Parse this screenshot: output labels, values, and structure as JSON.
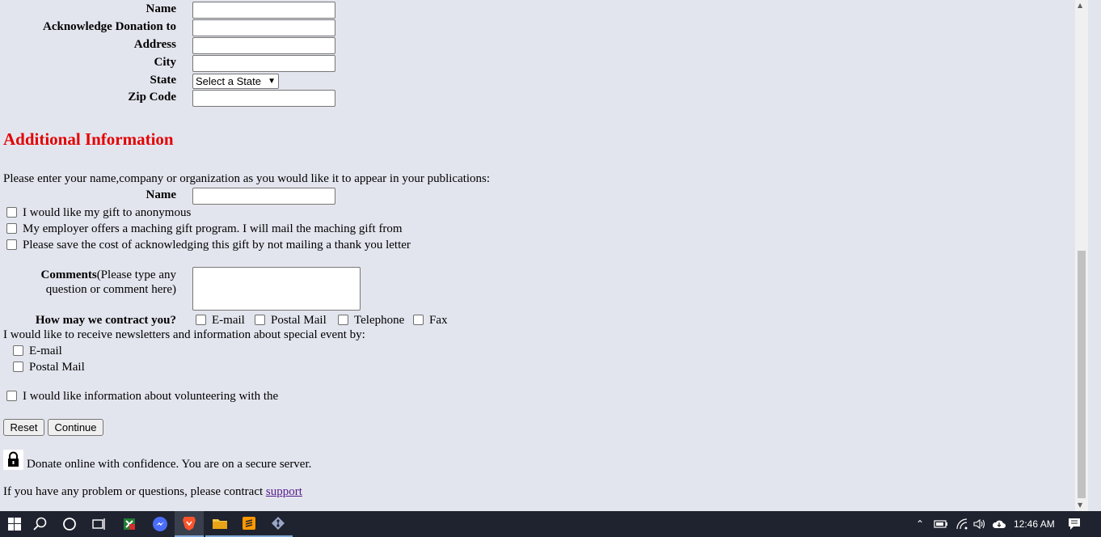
{
  "address_form": {
    "name_label": "Name",
    "acknowledge_label": "Acknowledge Donation to",
    "address_label": "Address",
    "city_label": "City",
    "state_label": "State",
    "state_select": "Select a State",
    "zip_label": "Zip Code"
  },
  "additional": {
    "heading": "Additional Information",
    "intro": "Please enter your name,company or organization as you would like it to appear in your publications:",
    "name_label": "Name",
    "checkbox_anonymous": "I would like my gift to anonymous",
    "checkbox_employer": "My employer offers a maching gift program. I will mail the maching gift from",
    "checkbox_save_cost": "Please save the cost of acknowledging this gift by not mailing a thank you letter",
    "comments_bold": "Comments",
    "comments_rest": "(Please type any",
    "comments_line2": "question or comment here)",
    "contact_label": "How may we contract you?",
    "contact_options": [
      "E-mail",
      "Postal Mail",
      "Telephone",
      "Fax"
    ],
    "newsletter_intro": "I would like to receive newsletters and information about special event by:",
    "newsletter_options": [
      "E-mail",
      "Postal Mail"
    ],
    "volunteer": "I would like information about volunteering with the"
  },
  "buttons": {
    "reset": "Reset",
    "continue": "Continue"
  },
  "footer": {
    "secure_text": "Donate online with confidence. You are on a secure server.",
    "support_prefix": "If you have any problem or questions, please contract",
    "support_link": "support"
  },
  "taskbar": {
    "time": "12:46 AM",
    "icons": [
      "windows-start-icon",
      "search-icon",
      "cortana-icon",
      "task-view-icon",
      "spreadsheet-app-icon",
      "messenger-icon",
      "brave-browser-icon",
      "file-explorer-icon",
      "sublime-text-icon",
      "git-app-icon"
    ]
  }
}
